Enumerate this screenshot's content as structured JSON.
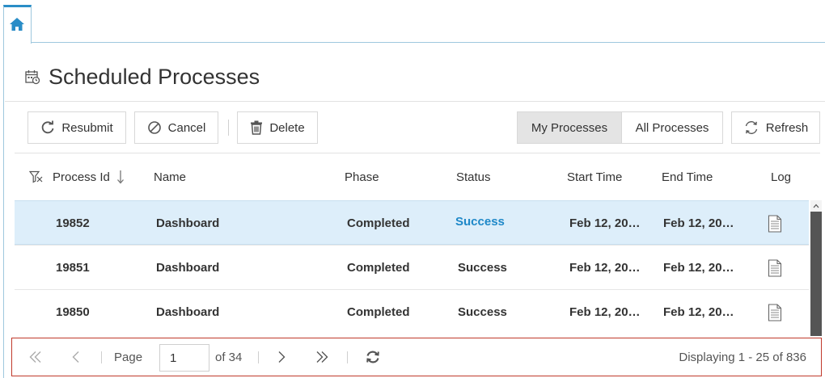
{
  "page": {
    "title": "Scheduled Processes"
  },
  "toolbar": {
    "resubmit_label": "Resubmit",
    "cancel_label": "Cancel",
    "delete_label": "Delete",
    "my_processes_label": "My Processes",
    "all_processes_label": "All Processes",
    "refresh_label": "Refresh",
    "active_filter": "My Processes"
  },
  "table": {
    "columns": [
      "Process Id",
      "Name",
      "Phase",
      "Status",
      "Start Time",
      "End Time",
      "Log"
    ],
    "sort_column": "Process Id",
    "sort_direction": "descending",
    "rows": [
      {
        "id": "19852",
        "name": "Dashboard",
        "phase": "Completed",
        "status": "Success",
        "start": "Feb 12, 20…",
        "end": "Feb 12, 20…",
        "selected": true
      },
      {
        "id": "19851",
        "name": "Dashboard",
        "phase": "Completed",
        "status": "Success",
        "start": "Feb 12, 20…",
        "end": "Feb 12, 20…",
        "selected": false
      },
      {
        "id": "19850",
        "name": "Dashboard",
        "phase": "Completed",
        "status": "Success",
        "start": "Feb 12, 20…",
        "end": "Feb 12, 20…",
        "selected": false
      }
    ]
  },
  "pager": {
    "page_label": "Page",
    "current_page": "1",
    "of_label": "of 34",
    "display_text": "Displaying 1 - 25 of 836"
  },
  "colors": {
    "accent": "#2a8dc7",
    "link": "#1e88c8",
    "selected_row": "#ddeefa",
    "pager_border": "#c0392b"
  },
  "icons": [
    "home-icon",
    "calendar-icon",
    "resubmit-icon",
    "cancel-icon",
    "trash-icon",
    "refresh-icon",
    "filter-icon",
    "sort-arrow-icon",
    "log-document-icon",
    "first-page-icon",
    "prev-page-icon",
    "next-page-icon",
    "last-page-icon",
    "pager-refresh-icon"
  ]
}
